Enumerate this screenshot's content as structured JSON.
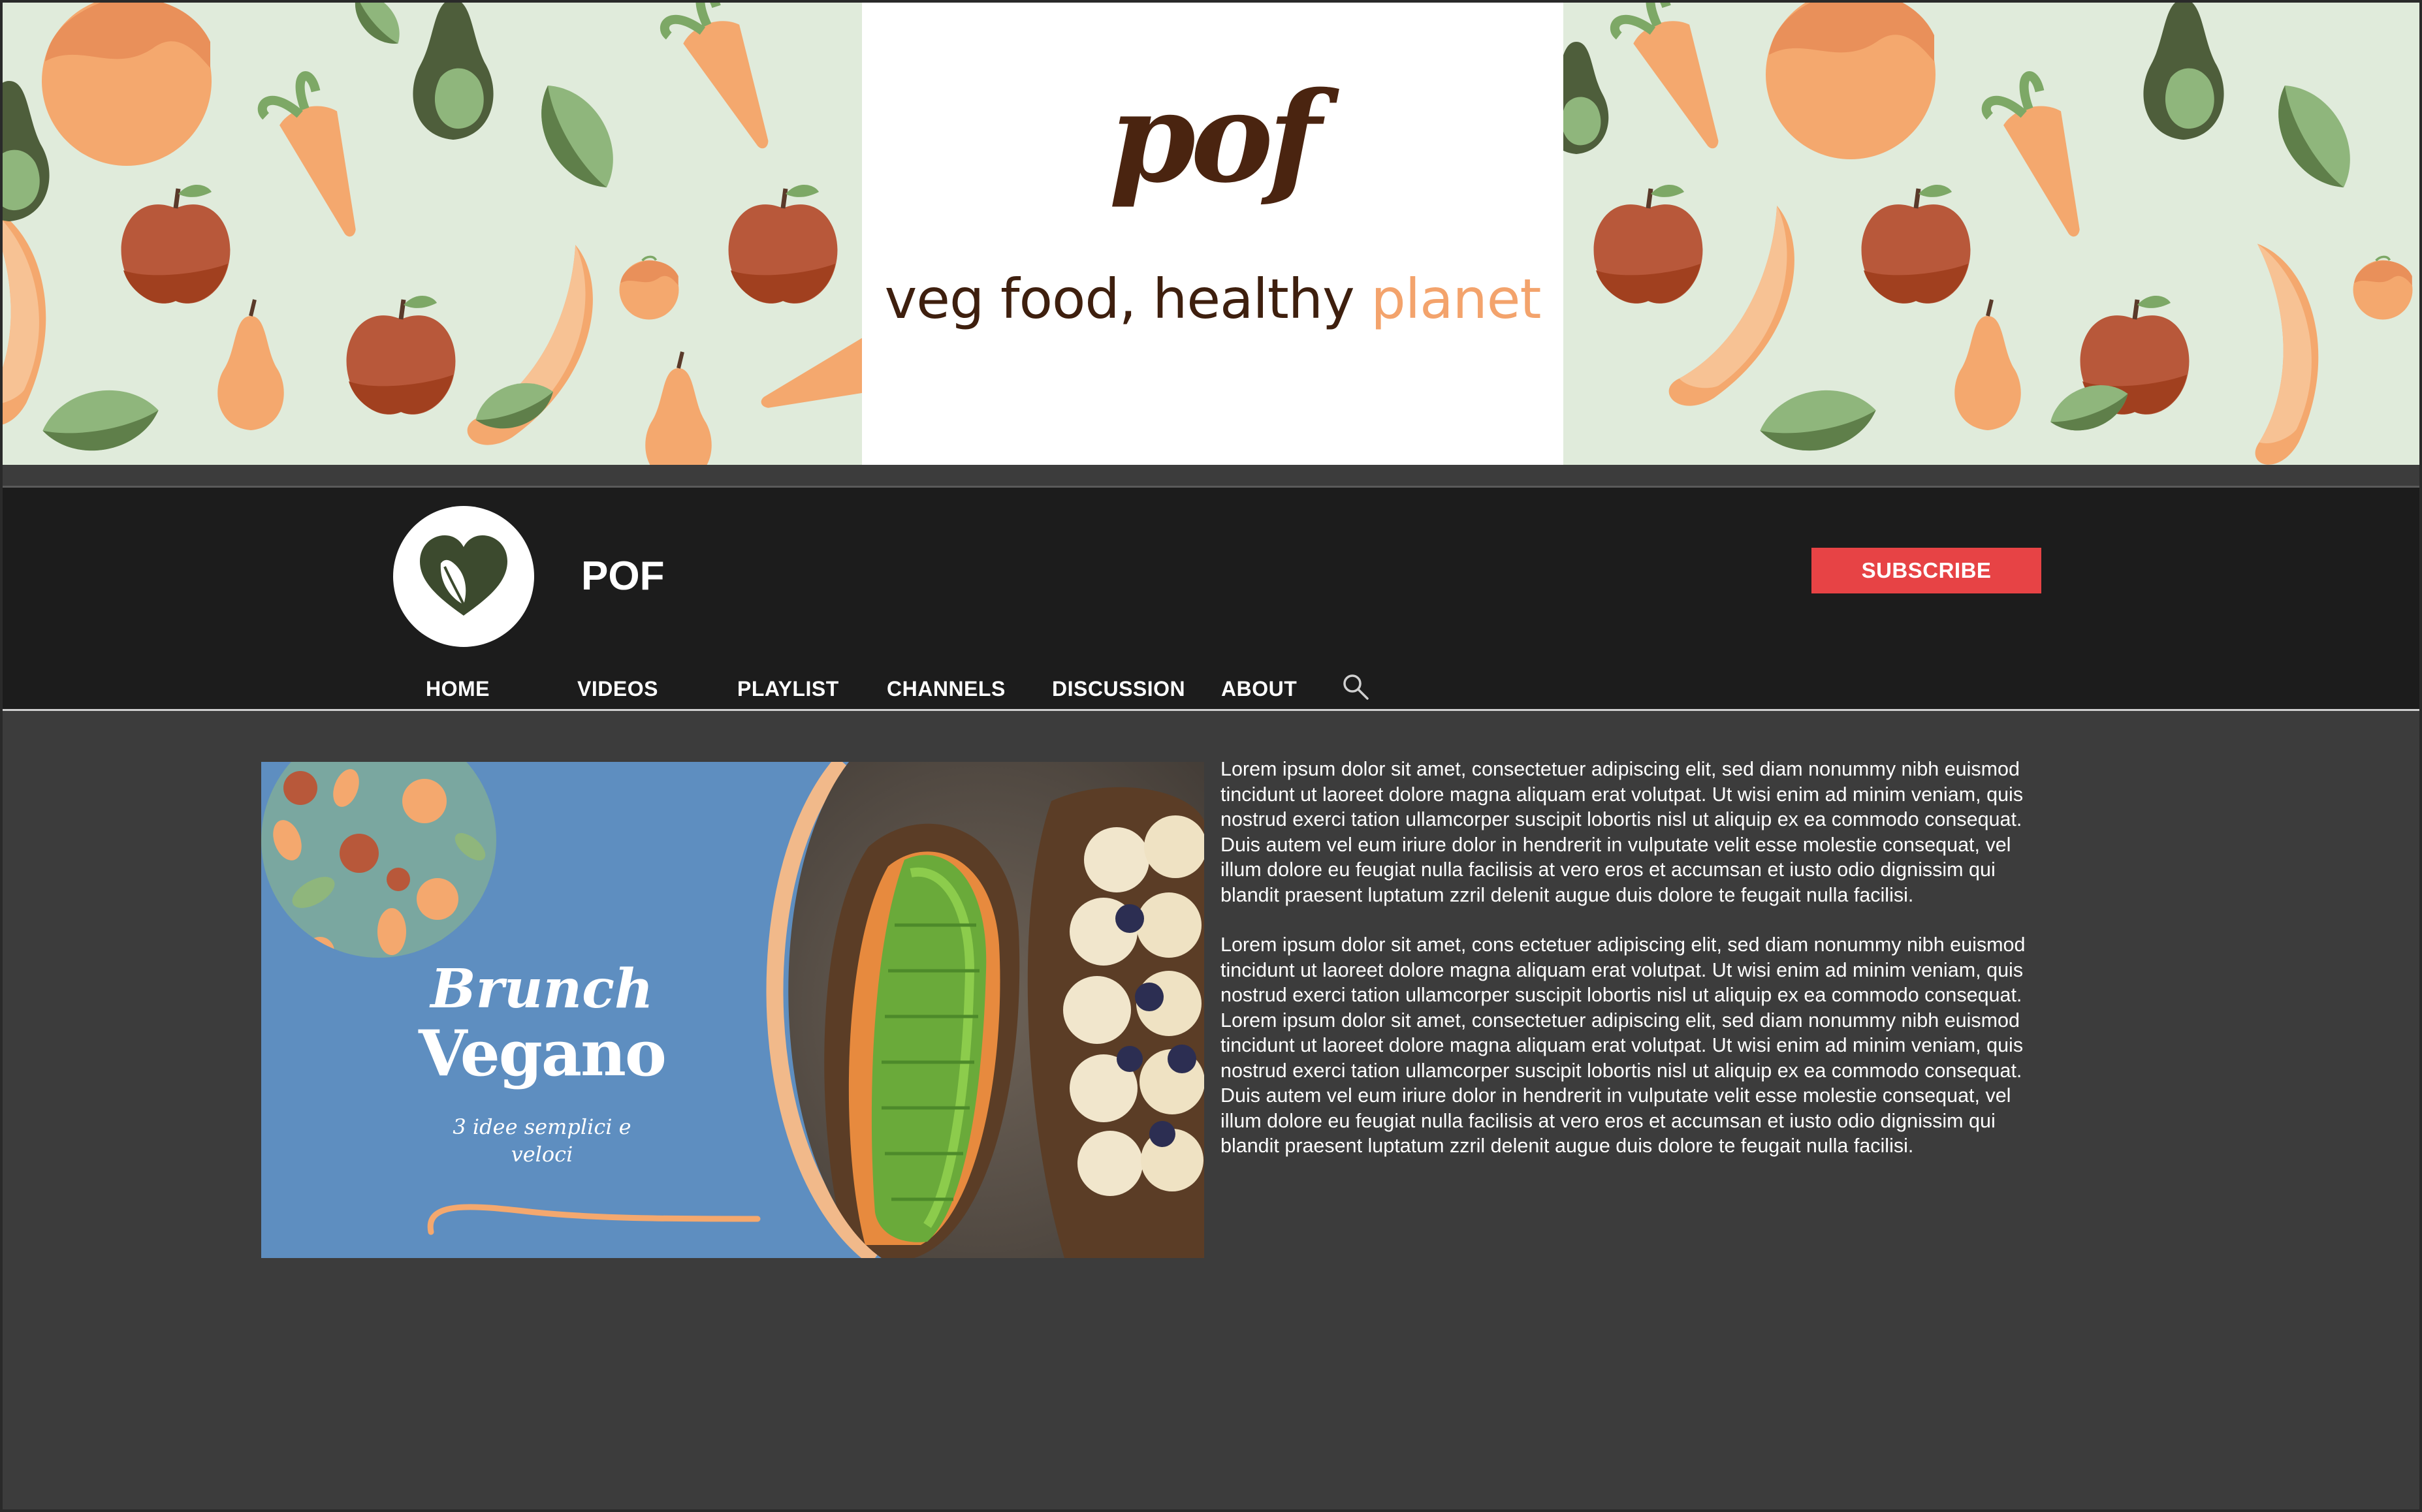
{
  "banner": {
    "logo": "pof",
    "tagline_main": "veg food, healthy ",
    "tagline_accent": "planet"
  },
  "channel": {
    "name": "POF",
    "subscribe_label": "SUBSCRIBE"
  },
  "tabs": [
    {
      "label": "HOME"
    },
    {
      "label": "VIDEOS"
    },
    {
      "label": "PLAYLIST"
    },
    {
      "label": "CHANNELS"
    },
    {
      "label": "DISCUSSION"
    },
    {
      "label": "ABOUT"
    }
  ],
  "featured_video": {
    "title_line1": "Brunch",
    "title_line2": "Vegano",
    "subtitle_line1": "3 idee semplici e",
    "subtitle_line2": "veloci"
  },
  "description": {
    "paragraph1": "Lorem ipsum dolor sit amet, consectetuer adipiscing elit, sed diam nonummy nibh euismod tincidunt ut laoreet dolore magna aliquam erat volutpat. Ut wisi enim ad minim veniam, quis nostrud exerci tation ullamcorper suscipit lobortis nisl ut aliquip ex ea commodo consequat. Duis autem vel eum iriure dolor in hendrerit in vulputate velit esse molestie consequat, vel illum dolore eu feugiat nulla facilisis at vero eros et accumsan et iusto odio dignissim qui blandit praesent luptatum zzril delenit augue duis dolore te feugait nulla facilisi.",
    "paragraph2": "Lorem ipsum dolor sit amet, cons ectetuer adipiscing elit, sed diam nonummy nibh euismod tincidunt ut laoreet dolore magna aliquam erat volutpat. Ut wisi enim ad minim veniam, quis nostrud exerci tation ullamcorper suscipit lobortis nisl ut aliquip ex ea commodo consequat. Lorem ipsum dolor sit amet, consectetuer adipiscing elit, sed diam nonummy nibh euismod tincidunt ut laoreet dolore magna aliquam erat volutpat. Ut wisi enim ad minim veniam, quis nostrud exerci tation ullamcorper suscipit lobortis nisl ut aliquip ex ea commodo consequat. Duis autem vel eum iriure dolor in hendrerit in vulputate velit esse molestie consequat, vel illum dolore eu feugiat nulla facilisis at vero eros et accumsan et iusto odio dignissim qui blandit praesent luptatum zzril delenit augue duis dolore te feugait nulla facilisi."
  },
  "icons": {
    "avatar": "heart-leaf-icon",
    "search": "search-icon"
  },
  "colors": {
    "banner_bg": "#e0ebdb",
    "brand_brown": "#4a2410",
    "accent_orange": "#f3a36c",
    "header_bg": "#1c1c1c",
    "content_bg": "#3c3c3c",
    "subscribe_red": "#e74345",
    "thumbnail_blue": "#5e8ec0"
  }
}
